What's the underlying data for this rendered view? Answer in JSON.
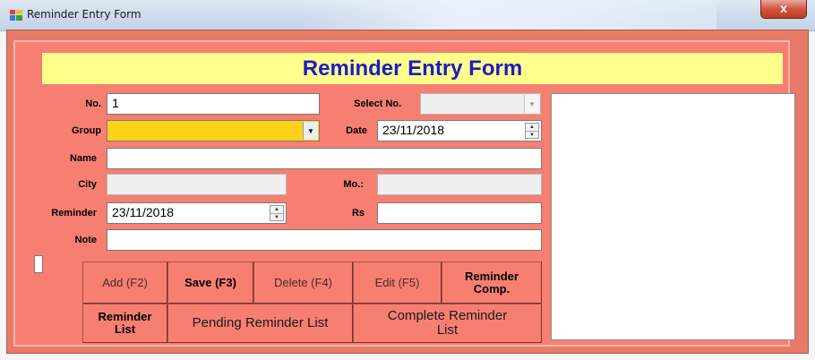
{
  "window": {
    "title": "Reminder Entry Form",
    "close_label": "x"
  },
  "form": {
    "heading": "Reminder Entry Form",
    "labels": {
      "no": "No.",
      "select_no": "Select No.",
      "group": "Group",
      "date": "Date",
      "name": "Name",
      "city": "City",
      "mobile": "Mo.:",
      "reminder": "Reminder",
      "rs": "Rs",
      "note": "Note"
    },
    "values": {
      "no": "1",
      "select_no": "",
      "group": "",
      "date": "23/11/2018",
      "name": "",
      "city": "",
      "mobile": "",
      "reminder": "23/11/2018",
      "rs": "",
      "note": ""
    }
  },
  "buttons": {
    "add": "Add (F2)",
    "save": "Save (F3)",
    "delete": "Delete (F4)",
    "edit": "Edit (F5)",
    "reminder_comp_line1": "Reminder",
    "reminder_comp_line2": "Comp.",
    "reminder_list_line1": "Reminder",
    "reminder_list_line2": "List",
    "pending": "Pending Reminder List",
    "complete_line1": "Complete Reminder",
    "complete_line2": "List"
  },
  "colors": {
    "form_bg": "#f77f72",
    "banner_bg": "#ffff8c",
    "banner_text": "#1c1cc8",
    "group_field_bg": "#ffd21a"
  }
}
